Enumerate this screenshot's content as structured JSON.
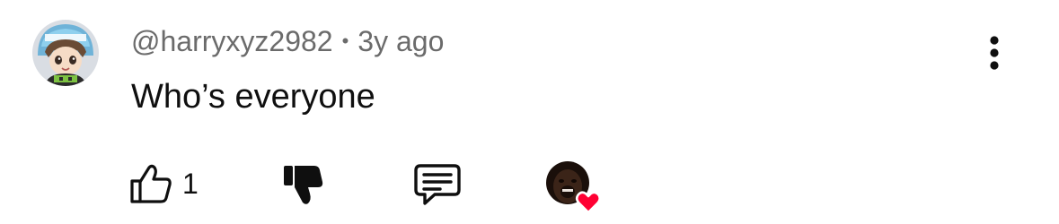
{
  "comment": {
    "author": "@harryxyz2982",
    "separator": "•",
    "time": "3y ago",
    "text": "Who’s everyone",
    "avatar_icon": "anime-character-avatar"
  },
  "actions": {
    "like_icon": "thumbs-up-icon",
    "like_count": "1",
    "dislike_icon": "thumbs-down-icon",
    "reply_icon": "comment-bubble-icon",
    "creator_heart_icon": "creator-heart-icon",
    "more_icon": "more-vertical-icon"
  },
  "colors": {
    "author_text": "#6b6b6b",
    "body_text": "#0f0f0f",
    "heart_red": "#ff0033"
  }
}
